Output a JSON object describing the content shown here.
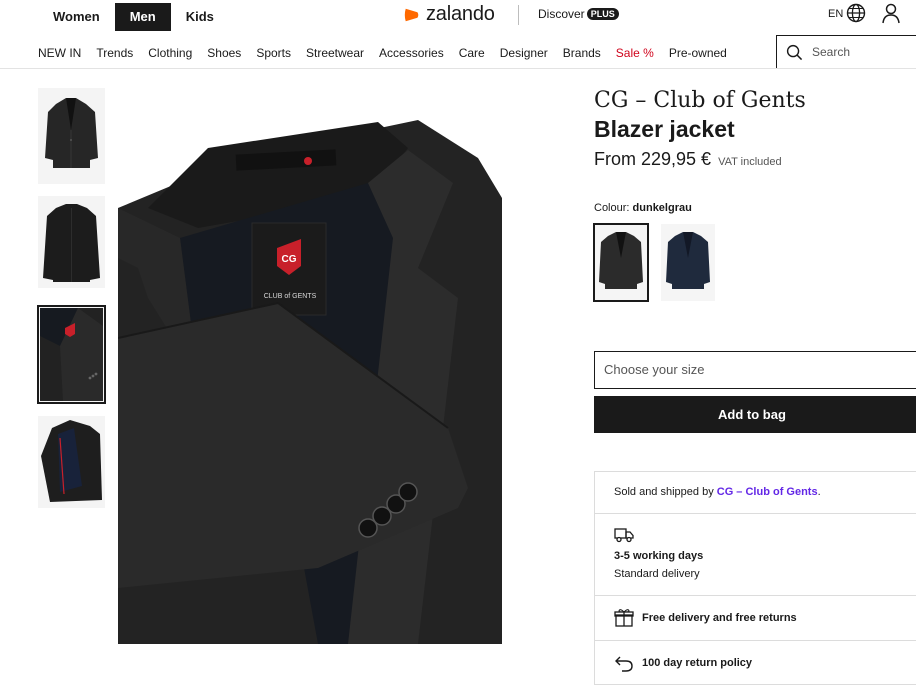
{
  "header": {
    "gender_tabs": [
      "Women",
      "Men",
      "Kids"
    ],
    "logo_text": "zalando",
    "discover_label": "Discover",
    "plus_badge": "PLUS",
    "language": "EN"
  },
  "nav": {
    "categories": [
      "NEW IN",
      "Trends",
      "Clothing",
      "Shoes",
      "Sports",
      "Streetwear",
      "Accessories",
      "Care",
      "Designer",
      "Brands",
      "Sale %",
      "Pre-owned"
    ],
    "search_placeholder": "Search"
  },
  "gallery": {
    "selected_index": 2,
    "main_label_line1": "CG",
    "main_label_line2": "CLUB of GENTS"
  },
  "product": {
    "brand": "CG – Club of Gents",
    "name": "Blazer jacket",
    "price": "From 229,95 €",
    "vat": "VAT included",
    "colour_label": "Colour:",
    "colour_value": "dunkelgrau",
    "swatch_colors": [
      "#2b2b2b",
      "#1f2a3d"
    ],
    "size_placeholder": "Choose your size",
    "add_to_bag": "Add to bag"
  },
  "delivery": {
    "sold_prefix": "Sold and shipped by",
    "seller": "CG – Club of Gents",
    "sold_suffix": ".",
    "days": "3-5 working days",
    "type": "Standard delivery",
    "free_delivery": "Free delivery and free returns",
    "return_policy": "100 day return policy"
  },
  "colors": {
    "accent": "#ff6900",
    "seller_link": "#6327e6",
    "sale": "#d0031b",
    "dark": "#1a1a1a"
  }
}
